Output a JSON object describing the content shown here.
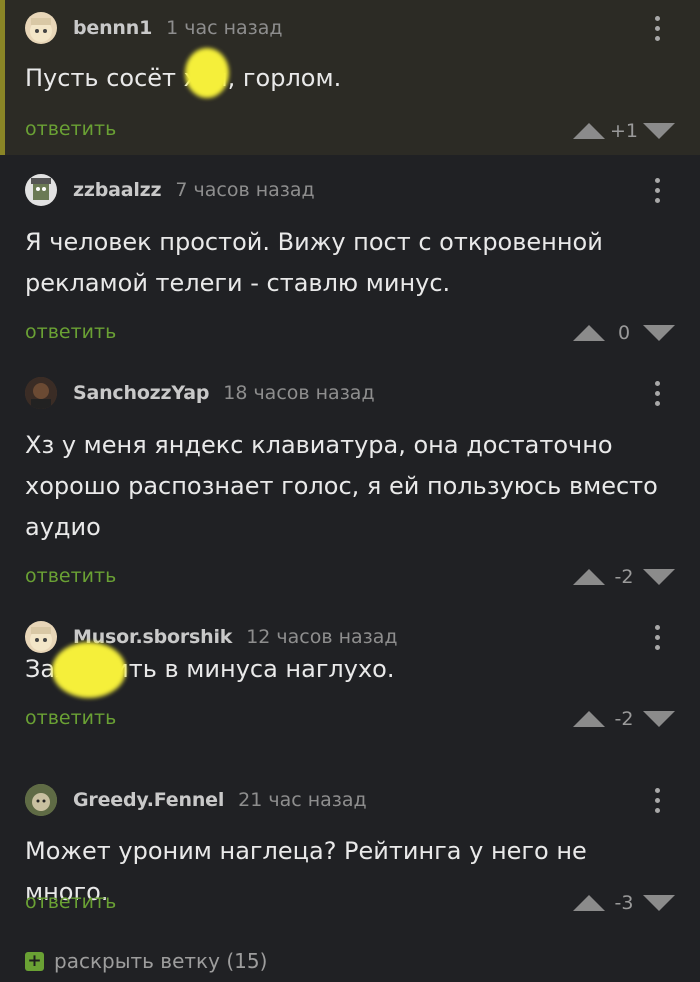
{
  "comments": [
    {
      "user": "bennn1",
      "time": "1 час назад",
      "text": "Пусть сосёт хуй, горлом.",
      "reply": "ответить",
      "score": "+1"
    },
    {
      "user": "zzbaalzz",
      "time": "7 часов назад",
      "text": "Я человек простой. Вижу пост с откровенной рекламой телеги - ставлю минус.",
      "reply": "ответить",
      "score": "0"
    },
    {
      "user": "SanchozzYap",
      "time": "18 часов назад",
      "text": "Хз у меня яндекс клавиатура, она достаточно хорошо распознает голос, я ей пользуюсь вместо аудио",
      "reply": "ответить",
      "score": "-2"
    },
    {
      "user": "Musor.sborshik",
      "time": "12 часов назад",
      "text": "Захуярить в минуса наглухо.",
      "reply": "ответить",
      "score": "-2"
    },
    {
      "user": "Greedy.Fennel",
      "time": "21 час назад",
      "text": "Может уроним наглеца? Рейтинга у него не много.",
      "reply": "ответить",
      "score": "-3"
    }
  ],
  "expand": {
    "icon": "+",
    "label": "раскрыть ветку (15)"
  },
  "colors": {
    "background": "#202124",
    "highlight": "#2c2b25",
    "accent": "#6aa134",
    "highlight_bar": "#8a8526"
  }
}
